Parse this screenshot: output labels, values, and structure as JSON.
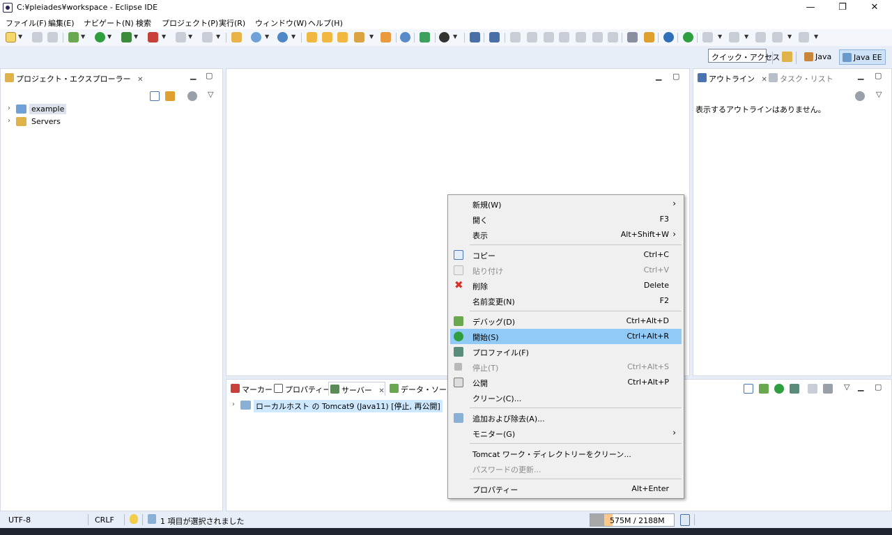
{
  "window": {
    "title": "C:¥pleiades¥workspace - Eclipse IDE",
    "minimize": "—",
    "restore": "❐",
    "close": "✕"
  },
  "menu": [
    "ファイル(F)",
    "編集(E)",
    "ナビゲート(N)",
    "検索",
    "プロジェクト(P)",
    "実行(R)",
    "ウィンドウ(W)",
    "ヘルプ(H)"
  ],
  "quick_access": "クイック・アクセス",
  "perspectives": [
    {
      "label": "Java",
      "active": false
    },
    {
      "label": "Java EE",
      "active": true
    }
  ],
  "project_explorer": {
    "tab_label": "プロジェクト・エクスプローラー",
    "items": [
      {
        "label": "example",
        "selected": true
      },
      {
        "label": "Servers",
        "selected": false
      }
    ]
  },
  "outline": {
    "tab_label": "アウトライン",
    "tab2_label": "タスク・リスト",
    "empty_message": "表示するアウトラインはありません。"
  },
  "bottom_tabs": [
    "マーカー",
    "プロパティー",
    "サーバー",
    "データ・ソース・"
  ],
  "server_row": "ローカルホスト の Tomcat9 (Java11)  [停止, 再公開]",
  "context_menu": [
    {
      "label": "新規(W)",
      "shortcut": "",
      "submenu": true
    },
    {
      "label": "開く",
      "shortcut": "F3"
    },
    {
      "label": "表示",
      "shortcut": "Alt+Shift+W",
      "submenu": true
    },
    {
      "label": "コピー",
      "shortcut": "Ctrl+C"
    },
    {
      "label": "貼り付け",
      "shortcut": "Ctrl+V",
      "disabled": true
    },
    {
      "label": "削除",
      "shortcut": "Delete"
    },
    {
      "label": "名前変更(N)",
      "shortcut": "F2"
    },
    {
      "label": "デバッグ(D)",
      "shortcut": "Ctrl+Alt+D"
    },
    {
      "label": "開始(S)",
      "shortcut": "Ctrl+Alt+R",
      "highlighted": true
    },
    {
      "label": "プロファイル(F)",
      "shortcut": ""
    },
    {
      "label": "停止(T)",
      "shortcut": "Ctrl+Alt+S",
      "disabled": true
    },
    {
      "label": "公開",
      "shortcut": "Ctrl+Alt+P"
    },
    {
      "label": "クリーン(C)...",
      "shortcut": ""
    },
    {
      "label": "追加および除去(A)...",
      "shortcut": ""
    },
    {
      "label": "モニター(G)",
      "shortcut": "",
      "submenu": true
    },
    {
      "label": "Tomcat ワーク・ディレクトリーをクリーン...",
      "shortcut": ""
    },
    {
      "label": "パスワードの更新...",
      "shortcut": "",
      "disabled": true
    },
    {
      "label": "プロパティー",
      "shortcut": "Alt+Enter"
    }
  ],
  "status": {
    "encoding": "UTF-8",
    "line_ending": "CRLF",
    "selection": "1 項目が選択されました",
    "heap": "575M / 2188M",
    "heap_used_fraction": 0.263
  },
  "colors": {
    "highlight": "#91c9f7",
    "heap_fill": "#ffc88a"
  }
}
